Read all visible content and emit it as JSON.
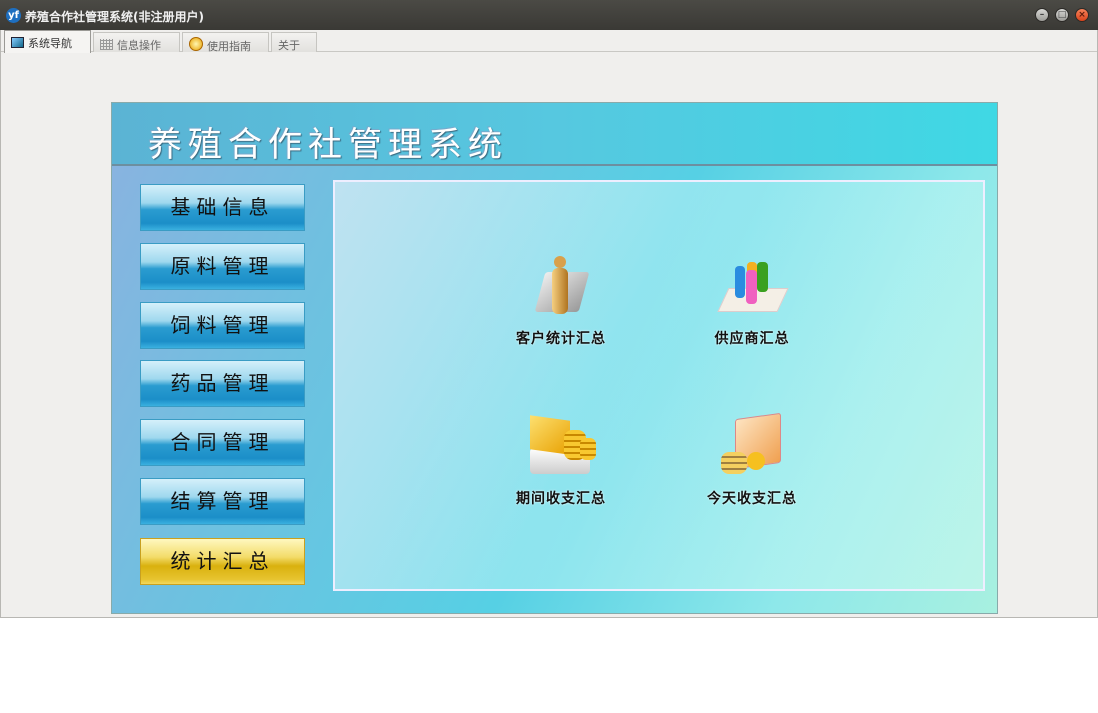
{
  "window": {
    "title": "养殖合作社管理系统(非注册用户)",
    "logo": "yf",
    "controls": [
      "minimize",
      "maximize",
      "close"
    ]
  },
  "tabs": [
    {
      "label": "系统导航",
      "icon": "monitor-icon",
      "active": true
    },
    {
      "label": "信息操作",
      "icon": "grid-icon"
    },
    {
      "label": "使用指南",
      "icon": "help-icon"
    },
    {
      "label": "关于"
    }
  ],
  "banner": {
    "title": "养殖合作社管理系统"
  },
  "nav": [
    {
      "label": "基础信息"
    },
    {
      "label": "原料管理"
    },
    {
      "label": "饲料管理"
    },
    {
      "label": "药品管理"
    },
    {
      "label": "合同管理"
    },
    {
      "label": "结算管理"
    },
    {
      "label": "统计汇总",
      "selected": true
    }
  ],
  "items": [
    {
      "label": "客户统计汇总",
      "icon": "customer-icon"
    },
    {
      "label": "供应商汇总",
      "icon": "supplier-icon"
    },
    {
      "label": "期间收支汇总",
      "icon": "period-income-icon"
    },
    {
      "label": "今天收支汇总",
      "icon": "today-income-icon"
    }
  ]
}
